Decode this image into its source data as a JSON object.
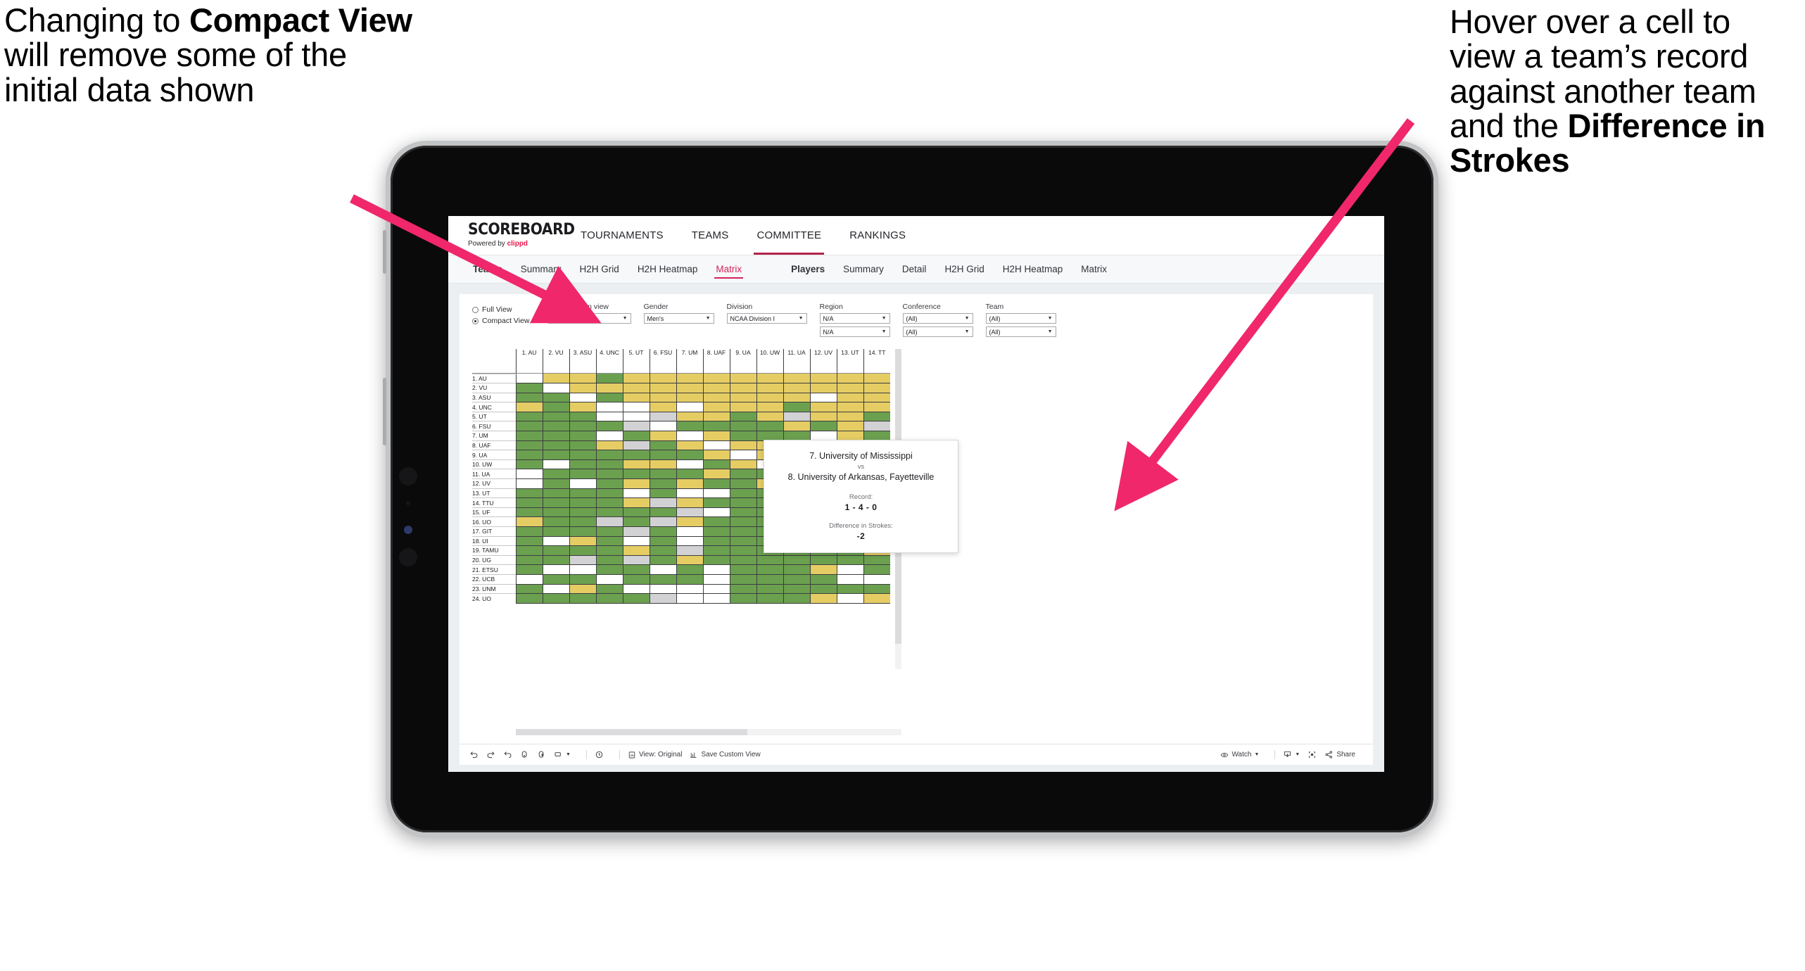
{
  "annotations": {
    "left": {
      "pre": "Changing to ",
      "bold": "Compact View",
      "post": " will remove some of the initial data shown"
    },
    "right": {
      "pre": "Hover over a cell to view a team’s record against another team and the ",
      "bold": "Difference in Strokes",
      "post": ""
    }
  },
  "brand": {
    "name": "SCOREBOARD",
    "powered_prefix": "Powered by ",
    "powered_name": "clippd"
  },
  "topnav": [
    {
      "label": "TOURNAMENTS",
      "active": false
    },
    {
      "label": "TEAMS",
      "active": false
    },
    {
      "label": "COMMITTEE",
      "active": true
    },
    {
      "label": "RANKINGS",
      "active": false
    }
  ],
  "subtabs": {
    "teams_group": "Teams",
    "teams": [
      "Summary",
      "H2H Grid",
      "H2H Heatmap",
      "Matrix"
    ],
    "teams_selected": "Matrix",
    "players_group": "Players",
    "players": [
      "Summary",
      "Detail",
      "H2H Grid",
      "H2H Heatmap",
      "Matrix"
    ]
  },
  "filters": {
    "view_mode": {
      "options": [
        "Full View",
        "Compact View"
      ],
      "selected": "Compact View"
    },
    "controls": [
      {
        "label": "Max teams in view",
        "values": [
          "Top 50"
        ]
      },
      {
        "label": "Gender",
        "values": [
          "Men's"
        ]
      },
      {
        "label": "Division",
        "values": [
          "NCAA Division I"
        ]
      },
      {
        "label": "Region",
        "values": [
          "N/A",
          "N/A"
        ]
      },
      {
        "label": "Conference",
        "values": [
          "(All)",
          "(All)"
        ]
      },
      {
        "label": "Team",
        "values": [
          "(All)",
          "(All)"
        ]
      }
    ]
  },
  "matrix": {
    "columns": [
      "1. AU",
      "2. VU",
      "3. ASU",
      "4. UNC",
      "5. UT",
      "6. FSU",
      "7. UM",
      "8. UAF",
      "9. UA",
      "10. UW",
      "11. UA",
      "12. UV",
      "13. UT",
      "14. TT"
    ],
    "rows": [
      "1. AU",
      "2. VU",
      "3. ASU",
      "4. UNC",
      "5. UT",
      "6. FSU",
      "7. UM",
      "8. UAF",
      "9. UA",
      "10. UW",
      "11. UA",
      "12. UV",
      "13. UT",
      "14. TTU",
      "15. UF",
      "16. UO",
      "17. GIT",
      "18. UI",
      "19. TAMU",
      "20. UG",
      "21. ETSU",
      "22. UCB",
      "23. UNM",
      "24. UO"
    ],
    "legend": {
      "win": "#6ba04f",
      "loss": "#e5cd64",
      "tie": "#d2d2d4",
      "none": "#ffffff"
    },
    "cells": [
      [
        "w",
        "y",
        "y",
        "g",
        "y",
        "y",
        "y",
        "y",
        "y",
        "y",
        "y",
        "y",
        "y",
        "y"
      ],
      [
        "g",
        "w",
        "y",
        "y",
        "y",
        "y",
        "y",
        "y",
        "y",
        "y",
        "y",
        "y",
        "y",
        "y"
      ],
      [
        "g",
        "g",
        "w",
        "g",
        "y",
        "y",
        "y",
        "y",
        "y",
        "y",
        "y",
        "w",
        "y",
        "y"
      ],
      [
        "y",
        "g",
        "y",
        "w",
        "w",
        "y",
        "w",
        "y",
        "y",
        "y",
        "g",
        "y",
        "y",
        "y"
      ],
      [
        "g",
        "g",
        "g",
        "w",
        "w",
        "x",
        "y",
        "y",
        "g",
        "y",
        "x",
        "y",
        "y",
        "g"
      ],
      [
        "g",
        "g",
        "g",
        "g",
        "x",
        "w",
        "g",
        "g",
        "g",
        "g",
        "y",
        "g",
        "y",
        "x"
      ],
      [
        "g",
        "g",
        "g",
        "w",
        "g",
        "y",
        "w",
        "y",
        "g",
        "g",
        "g",
        "w",
        "y",
        "g"
      ],
      [
        "g",
        "g",
        "g",
        "y",
        "x",
        "g",
        "y",
        "w",
        "y",
        "y",
        "y",
        "y",
        "y",
        "x"
      ],
      [
        "g",
        "g",
        "g",
        "g",
        "g",
        "g",
        "g",
        "y",
        "w",
        "y",
        "y",
        "y",
        "g",
        "y"
      ],
      [
        "g",
        "w",
        "g",
        "g",
        "y",
        "y",
        "w",
        "g",
        "y",
        "w",
        "g",
        "y",
        "y",
        "x"
      ],
      [
        "w",
        "g",
        "g",
        "g",
        "g",
        "g",
        "g",
        "y",
        "g",
        "g",
        "w",
        "y",
        "w",
        "y"
      ],
      [
        "w",
        "g",
        "w",
        "g",
        "y",
        "g",
        "y",
        "g",
        "g",
        "y",
        "g",
        "w",
        "w",
        "w"
      ],
      [
        "g",
        "g",
        "g",
        "g",
        "w",
        "g",
        "w",
        "w",
        "g",
        "g",
        "g",
        "g",
        "w",
        "g"
      ],
      [
        "g",
        "g",
        "g",
        "g",
        "y",
        "x",
        "y",
        "g",
        "g",
        "g",
        "y",
        "g",
        "y",
        "y"
      ],
      [
        "g",
        "g",
        "g",
        "g",
        "g",
        "g",
        "x",
        "w",
        "g",
        "g",
        "g",
        "g",
        "y",
        "y"
      ],
      [
        "y",
        "g",
        "g",
        "x",
        "g",
        "x",
        "y",
        "g",
        "g",
        "g",
        "g",
        "g",
        "y",
        "y"
      ],
      [
        "g",
        "g",
        "g",
        "g",
        "x",
        "g",
        "w",
        "g",
        "g",
        "g",
        "g",
        "g",
        "g",
        "w"
      ],
      [
        "g",
        "w",
        "y",
        "g",
        "w",
        "g",
        "w",
        "g",
        "g",
        "g",
        "g",
        "g",
        "g",
        "g"
      ],
      [
        "g",
        "g",
        "g",
        "g",
        "y",
        "g",
        "x",
        "g",
        "g",
        "g",
        "g",
        "g",
        "g",
        "y"
      ],
      [
        "g",
        "g",
        "x",
        "g",
        "x",
        "g",
        "y",
        "g",
        "g",
        "g",
        "g",
        "g",
        "g",
        "g"
      ],
      [
        "g",
        "w",
        "w",
        "g",
        "g",
        "w",
        "g",
        "w",
        "g",
        "g",
        "g",
        "y",
        "w",
        "g"
      ],
      [
        "w",
        "g",
        "g",
        "w",
        "g",
        "g",
        "g",
        "w",
        "g",
        "g",
        "g",
        "g",
        "w",
        "w"
      ],
      [
        "g",
        "w",
        "y",
        "g",
        "w",
        "w",
        "w",
        "w",
        "g",
        "g",
        "g",
        "g",
        "g",
        "g"
      ],
      [
        "g",
        "g",
        "g",
        "g",
        "g",
        "x",
        "w",
        "w",
        "g",
        "g",
        "g",
        "y",
        "w",
        "y"
      ]
    ]
  },
  "tooltip": {
    "team_a": "7. University of Mississippi",
    "vs": "vs",
    "team_b": "8. University of Arkansas, Fayetteville",
    "record_label": "Record:",
    "record_value": "1 - 4 - 0",
    "strokes_label": "Difference in Strokes:",
    "strokes_value": "-2"
  },
  "toolbar": {
    "view_original": "View: Original",
    "save_custom_view": "Save Custom View",
    "watch": "Watch",
    "share": "Share"
  }
}
